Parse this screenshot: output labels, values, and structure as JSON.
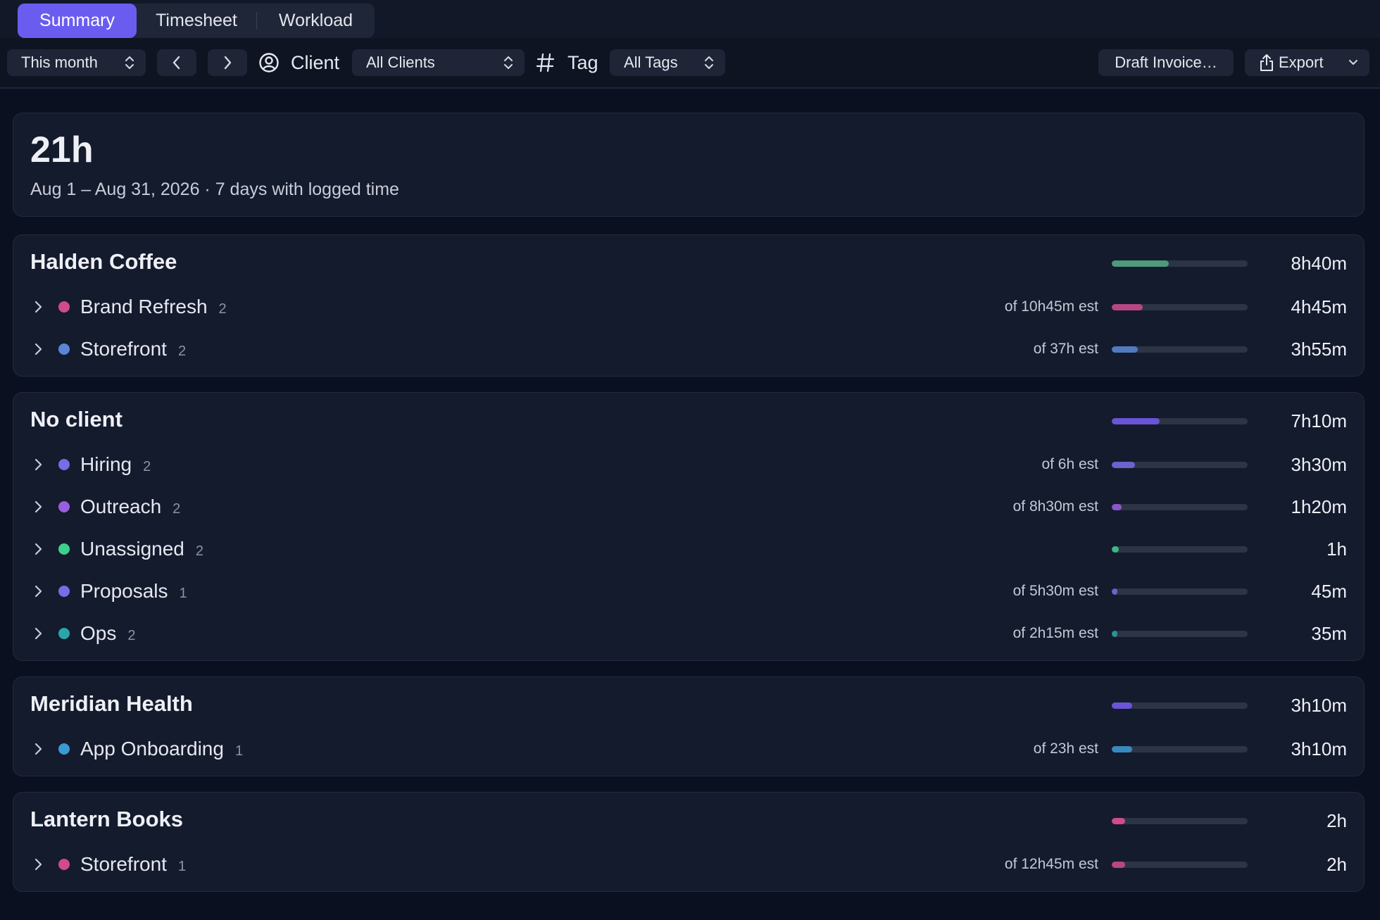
{
  "tabs": [
    {
      "label": "Summary",
      "active": true
    },
    {
      "label": "Timesheet",
      "active": false
    },
    {
      "label": "Workload",
      "active": false
    }
  ],
  "toolbar": {
    "period": "This month",
    "client_label": "Client",
    "client_value": "All Clients",
    "tag_label": "Tag",
    "tag_value": "All Tags",
    "draft_invoice": "Draft Invoice…",
    "export": "Export"
  },
  "summary": {
    "total": "21h",
    "range": "Aug 1 – Aug 31, 2026 · 7 days with logged time"
  },
  "groups": [
    {
      "name": "Halden Coffee",
      "total": "8h40m",
      "fraction": 0.42,
      "color": "#4e9a7c",
      "projects": [
        {
          "name": "Brand Refresh",
          "count": "2",
          "est": "of 10h45m est",
          "dur": "4h45m",
          "fraction": 0.23,
          "color": "#d04a90"
        },
        {
          "name": "Storefront",
          "count": "2",
          "est": "of 37h est",
          "dur": "3h55m",
          "fraction": 0.19,
          "color": "#5b86d6"
        }
      ]
    },
    {
      "name": "No client",
      "total": "7h10m",
      "fraction": 0.35,
      "color": "#6a54d8",
      "projects": [
        {
          "name": "Hiring",
          "count": "2",
          "est": "of 6h est",
          "dur": "3h30m",
          "fraction": 0.17,
          "color": "#7a6be6"
        },
        {
          "name": "Outreach",
          "count": "2",
          "est": "of 8h30m est",
          "dur": "1h20m",
          "fraction": 0.07,
          "color": "#9a5ee0"
        },
        {
          "name": "Unassigned",
          "count": "2",
          "est": "",
          "dur": "1h",
          "fraction": 0.05,
          "color": "#3ecf8e"
        },
        {
          "name": "Proposals",
          "count": "1",
          "est": "of 5h30m est",
          "dur": "45m",
          "fraction": 0.04,
          "color": "#7a6be6"
        },
        {
          "name": "Ops",
          "count": "2",
          "est": "of 2h15m est",
          "dur": "35m",
          "fraction": 0.03,
          "color": "#2aa6a8"
        }
      ]
    },
    {
      "name": "Meridian Health",
      "total": "3h10m",
      "fraction": 0.15,
      "color": "#6a54d8",
      "projects": [
        {
          "name": "App Onboarding",
          "count": "1",
          "est": "of 23h est",
          "dur": "3h10m",
          "fraction": 0.15,
          "color": "#3a9ad4"
        }
      ]
    },
    {
      "name": "Lantern Books",
      "total": "2h",
      "fraction": 0.1,
      "color": "#d04a90",
      "projects": [
        {
          "name": "Storefront",
          "count": "1",
          "est": "of 12h45m est",
          "dur": "2h",
          "fraction": 0.1,
          "color": "#d04a90"
        }
      ]
    }
  ]
}
